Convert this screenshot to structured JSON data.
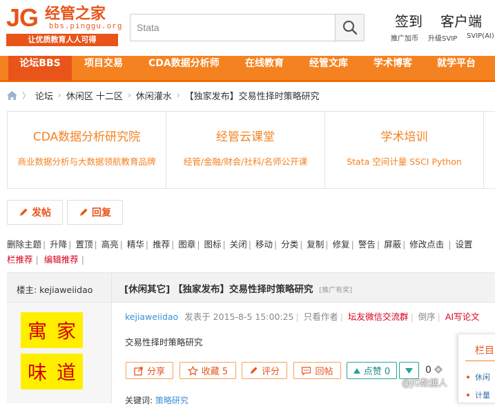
{
  "logo": {
    "brand": "JG",
    "name": "经管之家",
    "url": "bbs.pinggu.org",
    "slogan": "让优质教育人人可得"
  },
  "search": {
    "placeholder": "Stata"
  },
  "header": {
    "signin": "签到",
    "client": "客户端",
    "promote": "推广加币",
    "upgrade": "升级SVIP",
    "svip": "SVIP(AI)"
  },
  "nav": [
    "论坛BBS",
    "项目交易",
    "CDA数据分析师",
    "在线教育",
    "经管文库",
    "学术博客",
    "就学平台"
  ],
  "breadcrumb": [
    "论坛",
    "休闲区 十二区",
    "休闲灌水",
    "【独家发布】交易性择时策略研究"
  ],
  "promo": [
    {
      "title": "CDA数据分析研究院",
      "sub": "商业数据分析与大数据领航教育品牌"
    },
    {
      "title": "经管云课堂",
      "sub": "经管/金融/财会/社科/名师公开课"
    },
    {
      "title": "学术培训",
      "sub": "Stata 空间计量 SSCI Python"
    }
  ],
  "buttons": {
    "post": "发帖",
    "reply": "回复"
  },
  "mod_tools": [
    "删除主题",
    "升降",
    "置顶",
    "高亮",
    "精华",
    "推荐",
    "图章",
    "图标",
    "关闭",
    "移动",
    "分类",
    "复制",
    "修复",
    "警告",
    "屏蔽",
    "修改点击",
    "设置"
  ],
  "mod_tools2": [
    "栏推荐",
    "编辑推荐"
  ],
  "thread": {
    "author_label": "楼主: kejiaweiidao",
    "title": "[休闲其它] 【独家发布】交易性择时策略研究",
    "tag": "[推广有奖]",
    "seal_top": [
      "寓",
      "家"
    ],
    "seal_bottom": [
      "味",
      "道"
    ],
    "author": "kejiaweiidao",
    "posted": "发表于 2015-8-5 15:00:25",
    "only_author": "只看作者",
    "wechat": "坛友微信交流群",
    "reverse": "倒序",
    "ai": "AI写论文",
    "body": "交易性择时策略研究",
    "actions": {
      "share": "分享",
      "fav": "收藏 5",
      "rate": "评分",
      "reply": "回帖",
      "like": "点赞 0"
    },
    "zero": "0",
    "keywords_label": "关键词:",
    "keywords": "策略研究"
  },
  "side": {
    "title": "栏目",
    "items": [
      "休闲",
      "计量"
    ]
  },
  "watermark": "@JG数据人"
}
